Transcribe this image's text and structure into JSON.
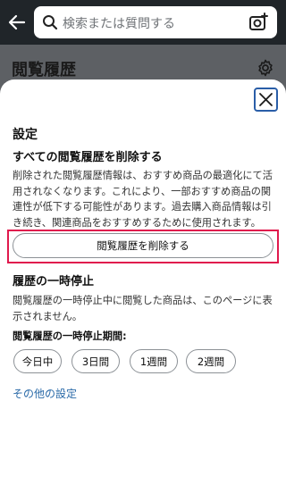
{
  "header": {
    "back_icon": "arrow-left-icon",
    "search_placeholder": "検索または質問する",
    "search_icon": "search-icon",
    "camera_icon": "camera-search-icon"
  },
  "page": {
    "title": "閲覧履歴",
    "settings_icon": "gear-icon"
  },
  "sheet": {
    "close_icon": "close-icon",
    "heading": "設定",
    "delete_all": {
      "title": "すべての閲覧履歴を削除する",
      "description": "削除された閲覧履歴情報は、おすすめ商品の最適化にて活用されなくなります。これにより、一部おすすめ商品の関連性が低下する可能性があります。過去購入商品情報は引き続き、関連商品をおすすめするために使用されます。",
      "button_label": "閲覧履歴を削除する"
    },
    "pause": {
      "title": "履歴の一時停止",
      "description": "閲覧履歴の一時停止中に閲覧した商品は、このページに表示されません。",
      "period_label": "閲覧履歴の一時停止期間:",
      "options": [
        "今日中",
        "3日間",
        "1週間",
        "2週間"
      ]
    },
    "other_settings_link": "その他の設定"
  },
  "colors": {
    "topbar": "#202529",
    "overlay": "#5d6064",
    "highlight": "#e0194d",
    "link": "#2a6aa8",
    "close_border": "#2a5ea8"
  }
}
